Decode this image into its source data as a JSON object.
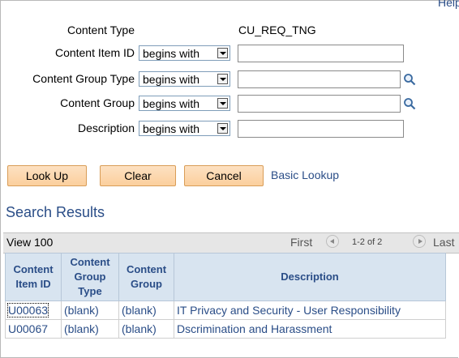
{
  "help_link": "Help",
  "form": {
    "content_type": {
      "label": "Content Type",
      "value": "CU_REQ_TNG"
    },
    "fields": [
      {
        "label": "Content Item ID",
        "operator": "begins with",
        "value": "",
        "lookup": false
      },
      {
        "label": "Content Group Type",
        "operator": "begins with",
        "value": "",
        "lookup": true
      },
      {
        "label": "Content Group",
        "operator": "begins with",
        "value": "",
        "lookup": true
      },
      {
        "label": "Description",
        "operator": "begins with",
        "value": "",
        "lookup": false
      }
    ]
  },
  "buttons": {
    "look_up": "Look Up",
    "clear": "Clear",
    "cancel": "Cancel",
    "basic_lookup": "Basic Lookup"
  },
  "results": {
    "title": "Search Results",
    "view_all": "View 100",
    "first": "First",
    "count": "1-2 of 2",
    "last": "Last",
    "columns": [
      "Content Item ID",
      "Content Group Type",
      "Content Group",
      "Description"
    ],
    "rows": [
      [
        "U00063",
        "(blank)",
        "(blank)",
        "IT Privacy and Security - User Responsibility"
      ],
      [
        "U00067",
        "(blank)",
        "(blank)",
        "Dscrimination and Harassment"
      ]
    ]
  },
  "colors": {
    "link": "#2a4d87",
    "button_bg": "#fbcf9d",
    "header_bg": "#d8e4f0"
  },
  "icons": {
    "lookup": "magnifier-icon",
    "dropdown": "dropdown-arrow-icon",
    "prev": "previous-page-icon",
    "next": "next-page-icon"
  }
}
